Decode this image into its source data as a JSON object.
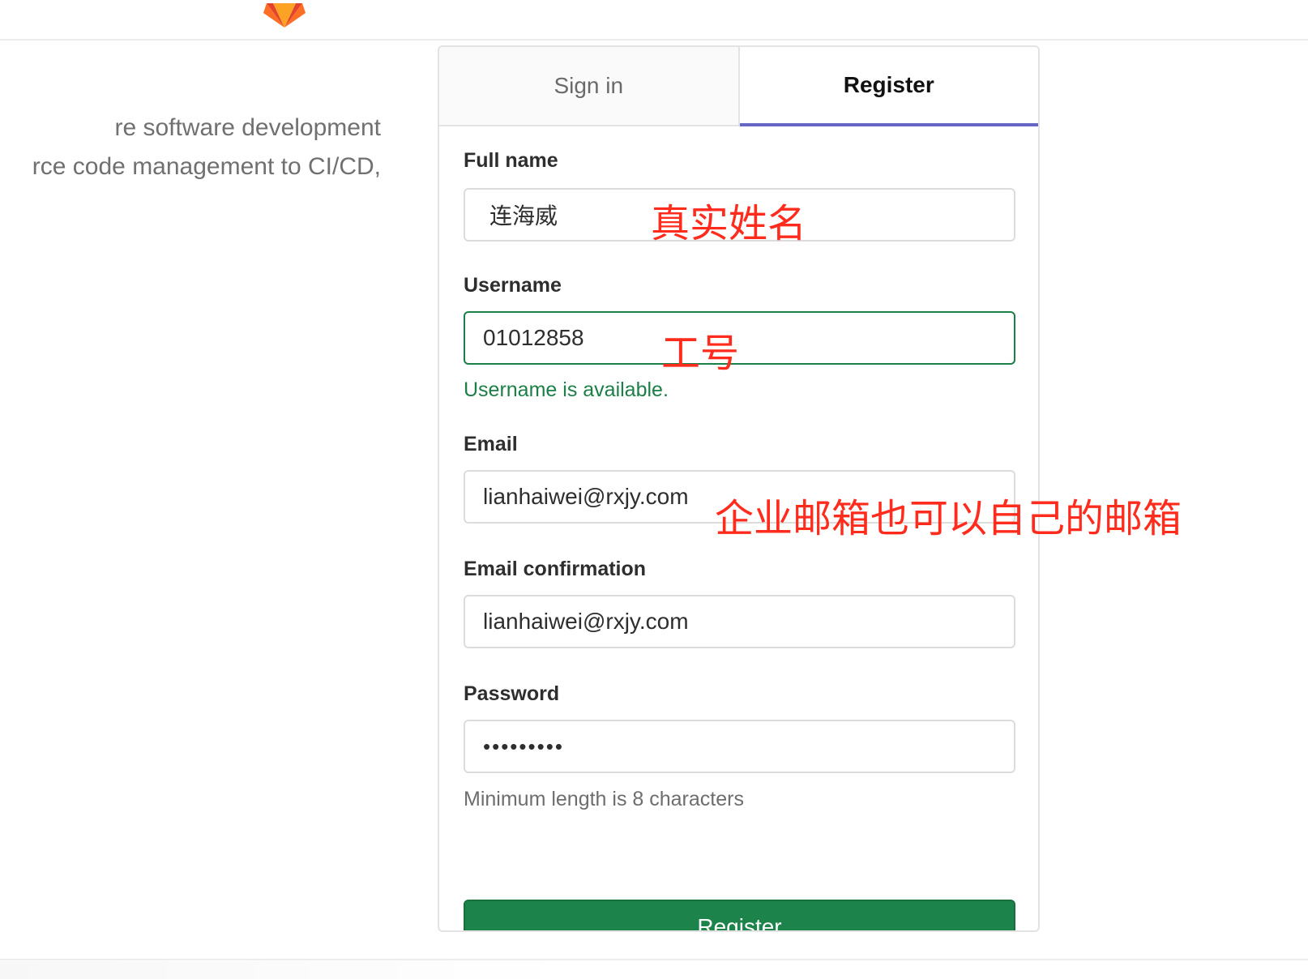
{
  "header": {
    "logo_icon": "gitlab-tanuki-icon"
  },
  "intro": {
    "line1": "re software development",
    "line2": "rce code management to CI/CD,"
  },
  "tabs": {
    "signin_label": "Sign in",
    "register_label": "Register"
  },
  "form": {
    "full_name": {
      "label": "Full name",
      "value": "连海威",
      "annotation": "真实姓名"
    },
    "username": {
      "label": "Username",
      "value": "01012858",
      "annotation": "工号",
      "status": "Username is available."
    },
    "email": {
      "label": "Email",
      "value": "lianhaiwei@rxjy.com",
      "annotation": "企业邮箱也可以自己的邮箱"
    },
    "email_confirmation": {
      "label": "Email confirmation",
      "value": "lianhaiwei@rxjy.com"
    },
    "password": {
      "label": "Password",
      "value": "•••••••••",
      "hint": "Minimum length is 8 characters"
    },
    "submit_label": "Register"
  },
  "colors": {
    "accent": "#6666c4",
    "success": "#1c844a",
    "annotation": "#ff2b1c"
  }
}
